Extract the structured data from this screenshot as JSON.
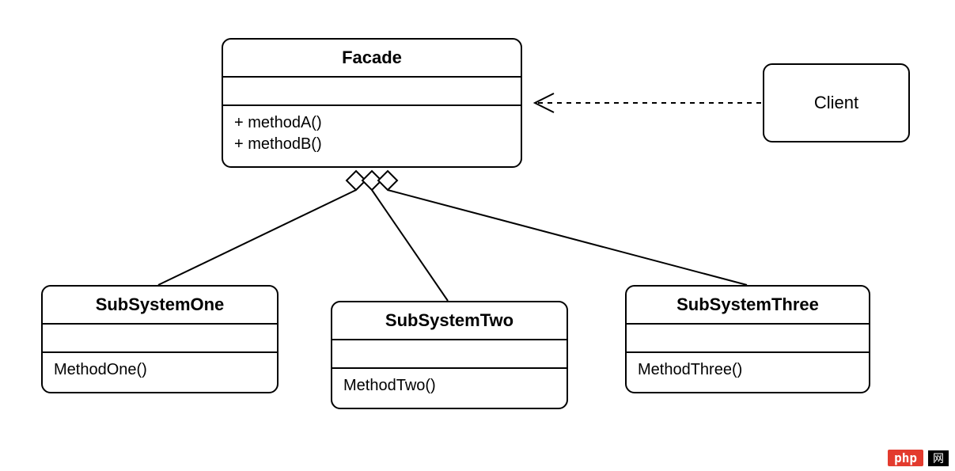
{
  "facade": {
    "name": "Facade",
    "methods": [
      "+ methodA()",
      "+ methodB()"
    ]
  },
  "client": {
    "name": "Client"
  },
  "subsystems": [
    {
      "name": "SubSystemOne",
      "method": "MethodOne()"
    },
    {
      "name": "SubSystemTwo",
      "method": "MethodTwo()"
    },
    {
      "name": "SubSystemThree",
      "method": "MethodThree()"
    }
  ],
  "relationships": {
    "client_to_facade": "dependency",
    "facade_to_subsystems": "aggregation"
  },
  "watermark": {
    "tag": "php",
    "suffix": "网"
  }
}
